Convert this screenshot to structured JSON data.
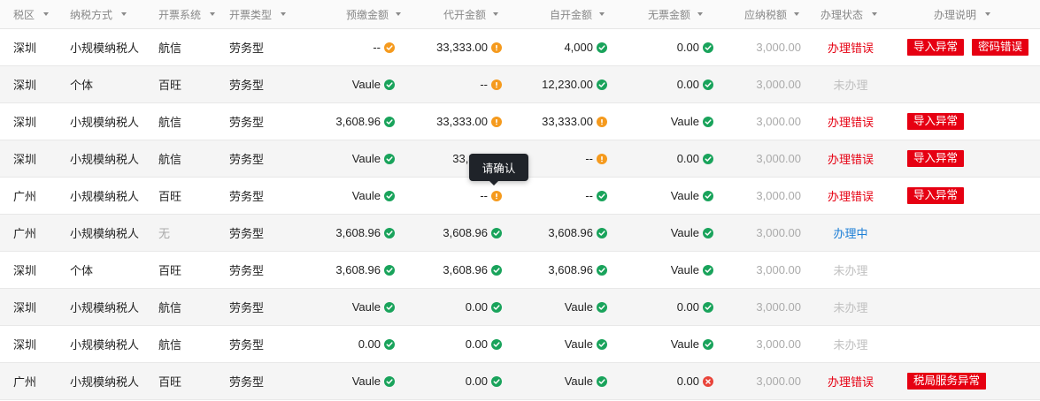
{
  "columns": [
    {
      "label": "税区"
    },
    {
      "label": "纳税方式"
    },
    {
      "label": "开票系统"
    },
    {
      "label": "开票类型"
    },
    {
      "label": "预缴金额"
    },
    {
      "label": "代开金额"
    },
    {
      "label": "自开金额"
    },
    {
      "label": "无票金额"
    },
    {
      "label": "应纳税额"
    },
    {
      "label": "办理状态"
    },
    {
      "label": "办理说明"
    }
  ],
  "rows": [
    {
      "region": "深圳",
      "tax_method": "小规模纳税人",
      "system": "航信",
      "invoice_type": "劳务型",
      "prepaid": {
        "value": "--",
        "icon": "warn-icon"
      },
      "agent": {
        "value": "33,333.00",
        "icon": "exclamation-icon"
      },
      "self": {
        "value": "4,000",
        "icon": "check-icon"
      },
      "noticket": {
        "value": "0.00",
        "icon": "check-icon"
      },
      "tax": "3,000.00",
      "status": "办理错误",
      "status_kind": "error",
      "notes": [
        "导入异常",
        "密码错误"
      ]
    },
    {
      "region": "深圳",
      "tax_method": "个体",
      "system": "百旺",
      "invoice_type": "劳务型",
      "prepaid": {
        "value": "Vaule",
        "icon": "check-icon"
      },
      "agent": {
        "value": "--",
        "icon": "exclamation-icon"
      },
      "self": {
        "value": "12,230.00",
        "icon": "check-icon"
      },
      "noticket": {
        "value": "0.00",
        "icon": "check-icon"
      },
      "tax": "3,000.00",
      "status": "未办理",
      "status_kind": "none",
      "notes": []
    },
    {
      "region": "深圳",
      "tax_method": "小规模纳税人",
      "system": "航信",
      "invoice_type": "劳务型",
      "prepaid": {
        "value": "3,608.96",
        "icon": "check-icon"
      },
      "agent": {
        "value": "33,333.00",
        "icon": "exclamation-icon"
      },
      "self": {
        "value": "33,333.00",
        "icon": "exclamation-icon"
      },
      "noticket": {
        "value": "Vaule",
        "icon": "check-icon"
      },
      "tax": "3,000.00",
      "status": "办理错误",
      "status_kind": "error",
      "notes": [
        "导入异常"
      ]
    },
    {
      "region": "深圳",
      "tax_method": "小规模纳税人",
      "system": "航信",
      "invoice_type": "劳务型",
      "prepaid": {
        "value": "Vaule",
        "icon": "check-icon"
      },
      "agent": {
        "value": "33,333",
        "icon": "exclamation-icon"
      },
      "self": {
        "value": "--",
        "icon": "exclamation-icon"
      },
      "noticket": {
        "value": "0.00",
        "icon": "check-icon"
      },
      "tax": "3,000.00",
      "status": "办理错误",
      "status_kind": "error",
      "notes": [
        "导入异常"
      ]
    },
    {
      "region": "广州",
      "tax_method": "小规模纳税人",
      "system": "百旺",
      "invoice_type": "劳务型",
      "prepaid": {
        "value": "Vaule",
        "icon": "check-icon"
      },
      "agent": {
        "value": "--",
        "icon": "exclamation-icon"
      },
      "self": {
        "value": "--",
        "icon": "check-icon"
      },
      "noticket": {
        "value": "Vaule",
        "icon": "check-icon"
      },
      "tax": "3,000.00",
      "status": "办理错误",
      "status_kind": "error",
      "notes": [
        "导入异常"
      ]
    },
    {
      "region": "广州",
      "tax_method": "小规模纳税人",
      "system": "无",
      "system_muted": true,
      "invoice_type": "劳务型",
      "prepaid": {
        "value": "3,608.96",
        "icon": "check-icon"
      },
      "agent": {
        "value": "3,608.96",
        "icon": "check-icon"
      },
      "self": {
        "value": "3,608.96",
        "icon": "check-icon"
      },
      "noticket": {
        "value": "Vaule",
        "icon": "check-icon"
      },
      "tax": "3,000.00",
      "status": "办理中",
      "status_kind": "doing",
      "notes": []
    },
    {
      "region": "深圳",
      "tax_method": "个体",
      "system": "百旺",
      "invoice_type": "劳务型",
      "prepaid": {
        "value": "3,608.96",
        "icon": "check-icon"
      },
      "agent": {
        "value": "3,608.96",
        "icon": "check-icon"
      },
      "self": {
        "value": "3,608.96",
        "icon": "check-icon"
      },
      "noticket": {
        "value": "Vaule",
        "icon": "check-icon"
      },
      "tax": "3,000.00",
      "status": "未办理",
      "status_kind": "none",
      "notes": []
    },
    {
      "region": "深圳",
      "tax_method": "小规模纳税人",
      "system": "航信",
      "invoice_type": "劳务型",
      "prepaid": {
        "value": "Vaule",
        "icon": "check-icon"
      },
      "agent": {
        "value": "0.00",
        "icon": "check-icon"
      },
      "self": {
        "value": "Vaule",
        "icon": "check-icon"
      },
      "noticket": {
        "value": "0.00",
        "icon": "check-icon"
      },
      "tax": "3,000.00",
      "status": "未办理",
      "status_kind": "none",
      "notes": []
    },
    {
      "region": "深圳",
      "tax_method": "小规模纳税人",
      "system": "航信",
      "invoice_type": "劳务型",
      "prepaid": {
        "value": "0.00",
        "icon": "check-icon"
      },
      "agent": {
        "value": "0.00",
        "icon": "check-icon"
      },
      "self": {
        "value": "Vaule",
        "icon": "check-icon"
      },
      "noticket": {
        "value": "Vaule",
        "icon": "check-icon"
      },
      "tax": "3,000.00",
      "status": "未办理",
      "status_kind": "none",
      "notes": []
    },
    {
      "region": "广州",
      "tax_method": "小规模纳税人",
      "system": "百旺",
      "invoice_type": "劳务型",
      "prepaid": {
        "value": "Vaule",
        "icon": "check-icon"
      },
      "agent": {
        "value": "0.00",
        "icon": "check-icon"
      },
      "self": {
        "value": "Vaule",
        "icon": "check-icon"
      },
      "noticket": {
        "value": "0.00",
        "icon": "error-icon"
      },
      "tax": "3,000.00",
      "status": "办理错误",
      "status_kind": "error",
      "notes": [
        "税局服务异常"
      ]
    }
  ],
  "tooltip": {
    "text": "请确认"
  },
  "colors": {
    "ok": "#19a35b",
    "warn": "#f59a1d",
    "error": "#e9443a",
    "status_error": "#e60012",
    "status_doing": "#1c7ed6",
    "tag_bg": "#e60012"
  }
}
